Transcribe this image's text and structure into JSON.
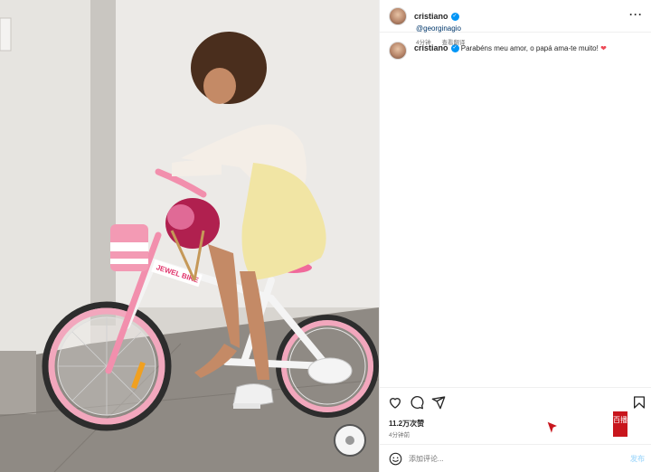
{
  "post": {
    "author": "cristiano",
    "caption": "Parabéns meu amor, o papá ama-te muito!",
    "caption_emoji": "❤",
    "mention": "@georginagio",
    "caption_time": "4分钟",
    "see_translation": "查看翻译",
    "more_label": "···"
  },
  "engagement": {
    "likes": "11.2万次赞",
    "time": "4分钟前"
  },
  "comment": {
    "placeholder": "添加评论...",
    "post_label": "发布"
  },
  "watermark": {
    "text": "百播"
  },
  "icons": [
    "verified-badge-icon",
    "heart-icon",
    "comment-icon",
    "share-icon",
    "bookmark-icon",
    "emoji-icon",
    "more-icon",
    "cursor-icon"
  ],
  "colors": {
    "accent": "#0095f6",
    "link": "#00376b",
    "heart": "#ed4956",
    "post_button": "#b2dffc",
    "watermark": "#c8161d"
  }
}
